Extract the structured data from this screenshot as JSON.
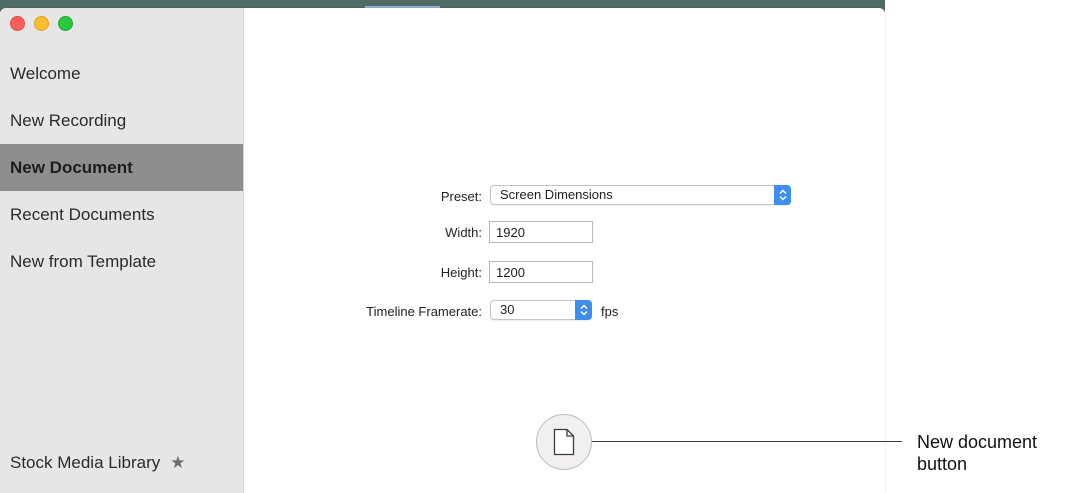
{
  "window": {
    "traffic_lights": [
      "close",
      "minimize",
      "maximize"
    ]
  },
  "sidebar": {
    "items": [
      {
        "label": "Welcome",
        "active": false
      },
      {
        "label": "New Recording",
        "active": false
      },
      {
        "label": "New Document",
        "active": true
      },
      {
        "label": "Recent Documents",
        "active": false
      },
      {
        "label": "New from Template",
        "active": false
      }
    ],
    "stock_library": {
      "label": "Stock Media Library",
      "icon": "star-icon"
    }
  },
  "form": {
    "preset": {
      "label": "Preset:",
      "value": "Screen Dimensions"
    },
    "width": {
      "label": "Width:",
      "value": "1920"
    },
    "height": {
      "label": "Height:",
      "value": "1200"
    },
    "framerate": {
      "label": "Timeline Framerate:",
      "value": "30",
      "unit": "fps"
    }
  },
  "new_document_button": {
    "icon": "document-icon"
  },
  "callout": {
    "text": "New document button"
  },
  "colors": {
    "accent": "#3d8ef0",
    "sidebar_bg": "#e5e6e5",
    "sidebar_active": "#8e8e8e"
  }
}
